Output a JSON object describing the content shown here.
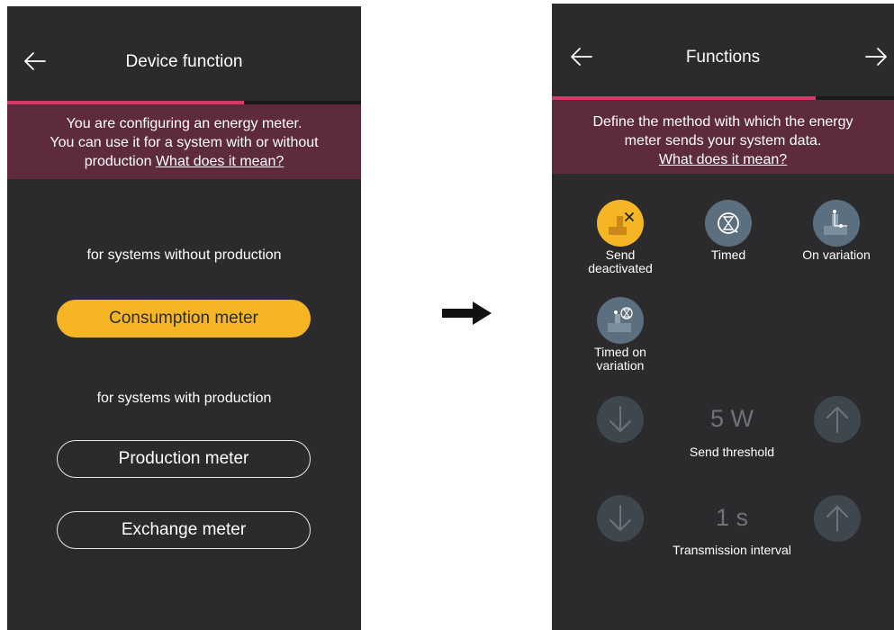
{
  "left_screen": {
    "title": "Device function",
    "progress": 0.67,
    "banner": {
      "line1": "You are configuring an energy meter.",
      "line2": "You can use it for a system with or without",
      "line3": "production",
      "link": "What does it mean?"
    },
    "without_production_label": "for systems without production",
    "consumption_button": "Consumption meter",
    "with_production_label": "for systems with production",
    "production_button": "Production meter",
    "exchange_button": "Exchange meter"
  },
  "right_screen": {
    "title": "Functions",
    "progress": 0.77,
    "banner": {
      "line1": "Define the method with which the energy",
      "line2": "meter sends your system data.",
      "link": "What does it mean?"
    },
    "functions": [
      {
        "line1": "Send",
        "line2": "deactivated",
        "active": true
      },
      {
        "line1": "Timed",
        "line2": "",
        "active": false
      },
      {
        "line1": "On variation",
        "line2": "",
        "active": false
      },
      {
        "line1": "Timed on",
        "line2": "variation",
        "active": false
      }
    ],
    "threshold": {
      "value": "5 W",
      "label": "Send threshold"
    },
    "interval": {
      "value": "1 s",
      "label": "Transmission interval"
    }
  },
  "colors": {
    "accent": "#f5b524",
    "progress": "#d23c67",
    "banner": "#5e2a3d",
    "background": "#2b2b2e"
  },
  "icons": [
    "back-arrow-icon",
    "forward-arrow-icon",
    "right-arrow-icon",
    "send-deactivated-icon",
    "hourglass-icon",
    "on-variation-icon",
    "timed-on-variation-icon",
    "down-arrow-icon",
    "up-arrow-icon"
  ]
}
